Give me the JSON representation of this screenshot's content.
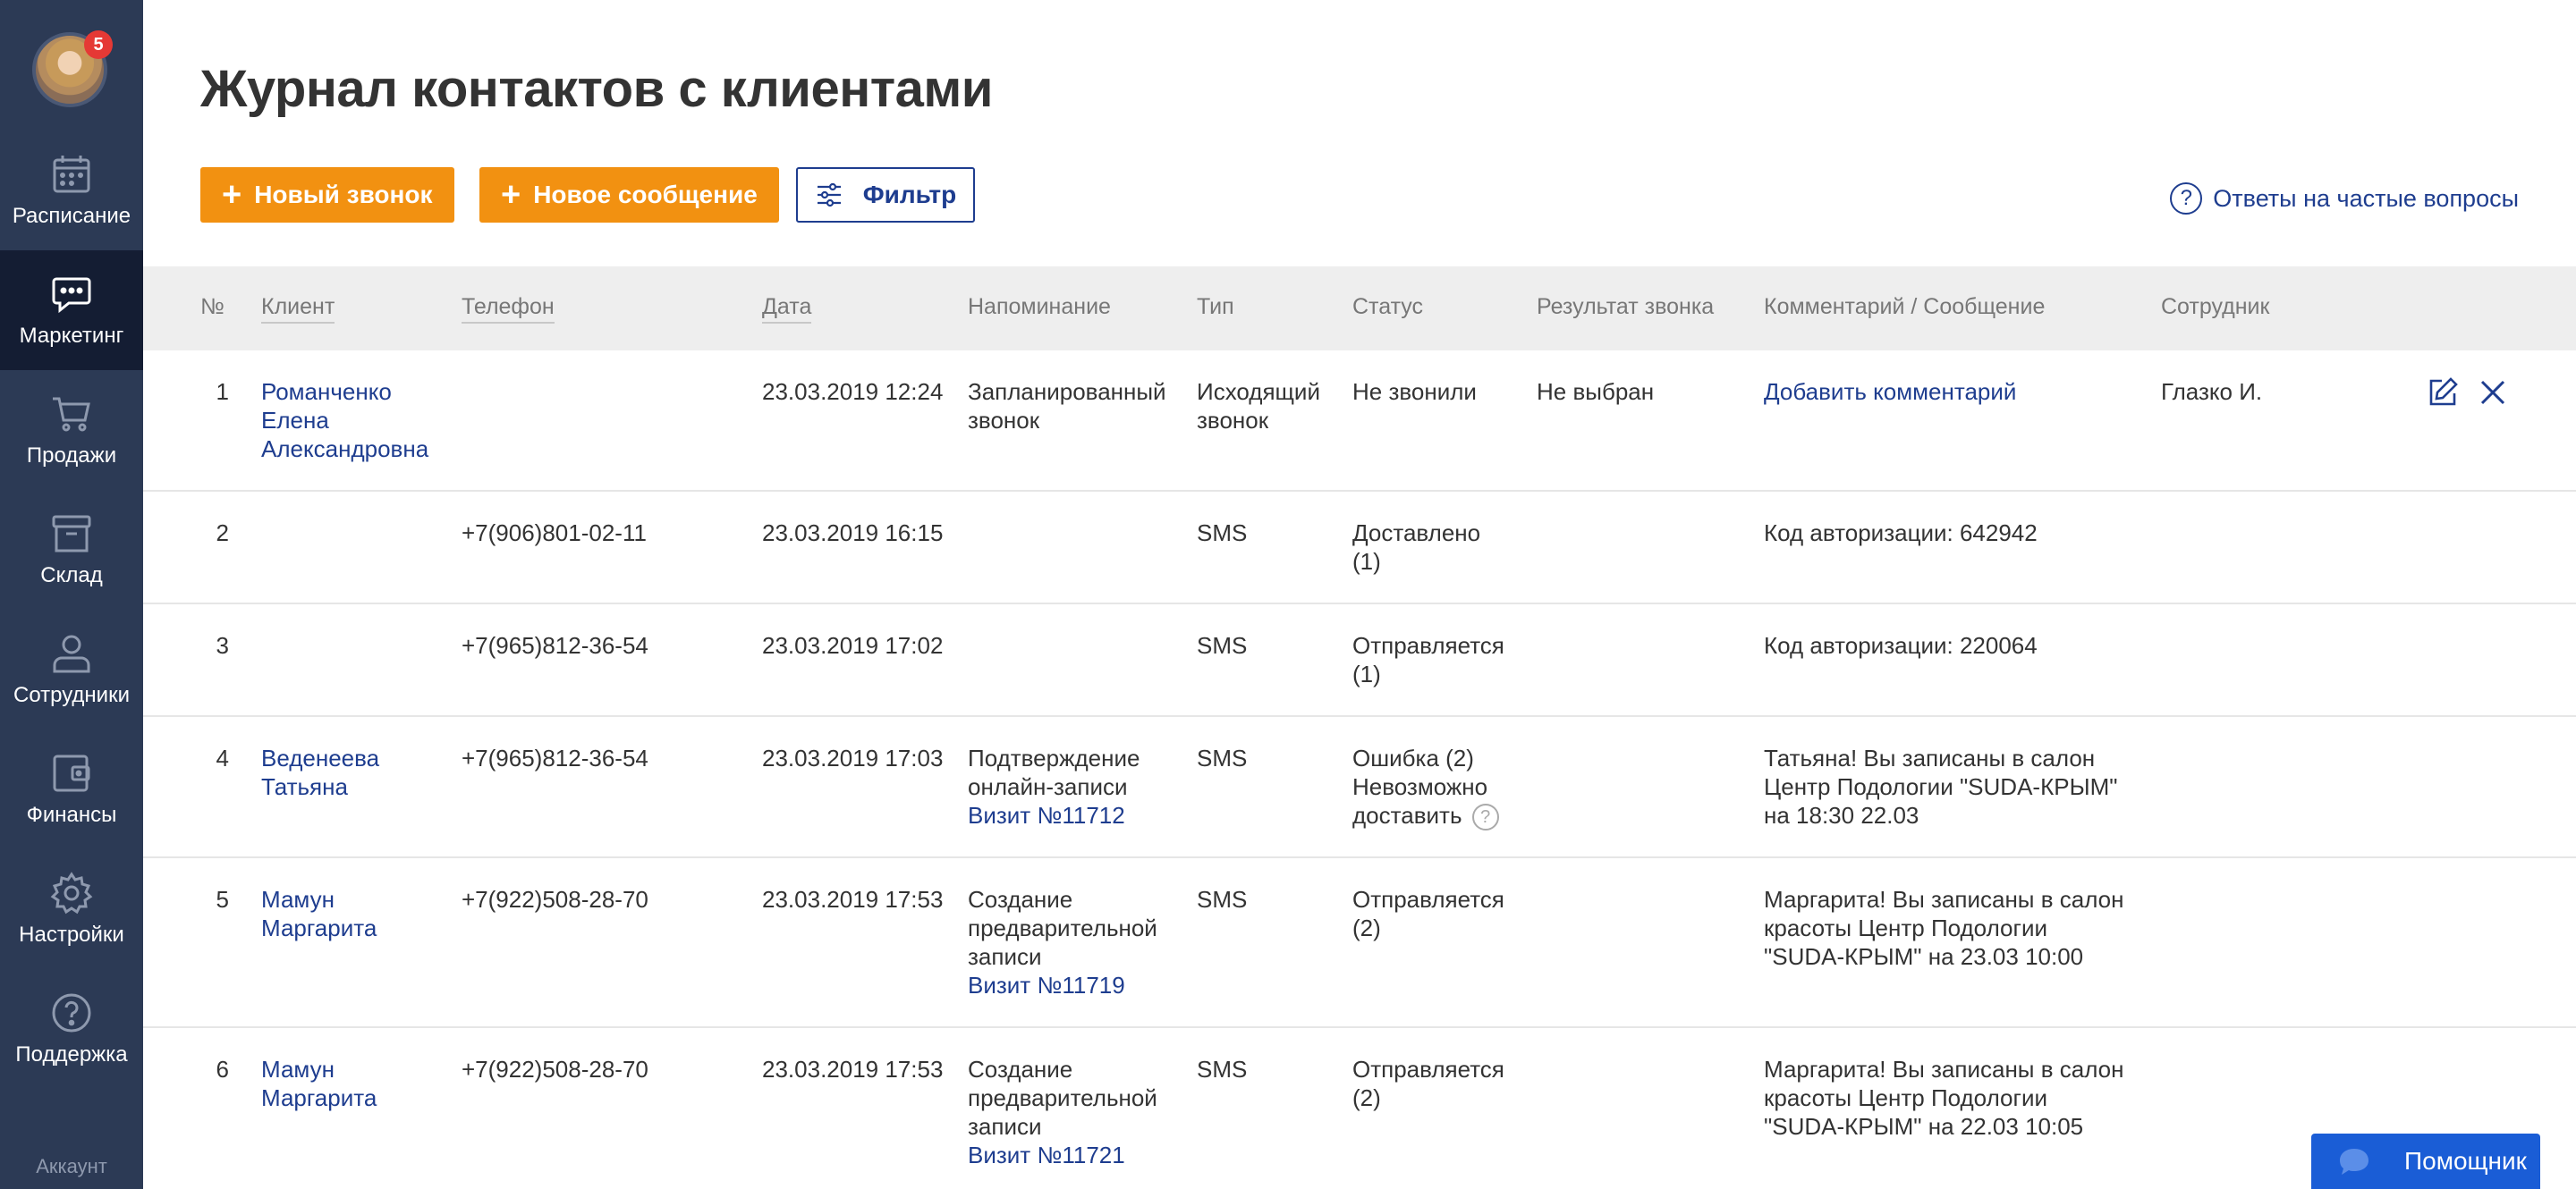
{
  "sidebar": {
    "avatar_badge": "5",
    "items": [
      {
        "label": "Расписание",
        "icon": "calendar-icon"
      },
      {
        "label": "Маркетинг",
        "icon": "chat-icon",
        "active": true
      },
      {
        "label": "Продажи",
        "icon": "cart-icon"
      },
      {
        "label": "Склад",
        "icon": "box-icon"
      },
      {
        "label": "Сотрудники",
        "icon": "user-icon"
      },
      {
        "label": "Финансы",
        "icon": "wallet-icon"
      },
      {
        "label": "Настройки",
        "icon": "gear-icon"
      },
      {
        "label": "Поддержка",
        "icon": "help-icon"
      }
    ],
    "account_label": "Аккаунт"
  },
  "page": {
    "title": "Журнал контактов с клиентами",
    "new_call": "Новый звонок",
    "new_message": "Новое сообщение",
    "filter": "Фильтр",
    "faq": "Ответы на частые вопросы",
    "faq_icon": "?"
  },
  "table": {
    "headers": {
      "num": "№",
      "client": "Клиент",
      "phone": "Телефон",
      "date": "Дата",
      "reminder": "Напоминание",
      "type": "Тип",
      "status": "Статус",
      "result": "Результат звонка",
      "comment": "Комментарий / Сообщение",
      "employee": "Сотрудник"
    },
    "rows": [
      {
        "num": "1",
        "client": [
          "Романченко",
          "Елена",
          "Александровна"
        ],
        "phone": "",
        "date": "23.03.2019 12:24",
        "reminder": [
          "Запланированный",
          "звонок"
        ],
        "type": [
          "Исходящий",
          "звонок"
        ],
        "status": [
          "Не звонили"
        ],
        "result": "Не выбран",
        "comment_link": "Добавить комментарий",
        "employee": "Глазко И."
      },
      {
        "num": "2",
        "phone": "+7(906)801-02-11",
        "date": "23.03.2019 16:15",
        "type": [
          "SMS"
        ],
        "status": [
          "Доставлено",
          "(1)"
        ],
        "comment": [
          "Код авторизации: 642942"
        ]
      },
      {
        "num": "3",
        "phone": "+7(965)812-36-54",
        "date": "23.03.2019 17:02",
        "type": [
          "SMS"
        ],
        "status": [
          "Отправляется",
          "(1)"
        ],
        "comment": [
          "Код авторизации: 220064"
        ]
      },
      {
        "num": "4",
        "client": [
          "Веденеева",
          "Татьяна"
        ],
        "phone": "+7(965)812-36-54",
        "date": "23.03.2019 17:03",
        "reminder": [
          "Подтверждение",
          "онлайн-записи"
        ],
        "visit_link": "Визит №11712",
        "type": [
          "SMS"
        ],
        "status": [
          "Ошибка (2)",
          "Невозможно",
          "доставить"
        ],
        "comment": [
          "Татьяна! Вы записаны в салон",
          "Центр Подологии \"SUDA-КРЫМ\"",
          "на 18:30 22.03"
        ]
      },
      {
        "num": "5",
        "client": [
          "Мамун",
          "Маргарита"
        ],
        "phone": "+7(922)508-28-70",
        "date": "23.03.2019 17:53",
        "reminder": [
          "Создание",
          "предварительной",
          "записи"
        ],
        "visit_link": "Визит №11719",
        "type": [
          "SMS"
        ],
        "status": [
          "Отправляется",
          "(2)"
        ],
        "comment": [
          "Маргарита! Вы записаны в салон",
          "красоты Центр Подологии",
          "\"SUDA-КРЫМ\" на 23.03 10:00"
        ]
      },
      {
        "num": "6",
        "client": [
          "Мамун",
          "Маргарита"
        ],
        "phone": "+7(922)508-28-70",
        "date": "23.03.2019 17:53",
        "reminder": [
          "Создание",
          "предварительной",
          "записи"
        ],
        "visit_link": "Визит №11721",
        "type": [
          "SMS"
        ],
        "status": [
          "Отправляется",
          "(2)"
        ],
        "comment": [
          "Маргарита! Вы записаны в салон",
          "красоты Центр Подологии",
          "\"SUDA-КРЫМ\" на 22.03 10:05"
        ]
      }
    ]
  },
  "helper": {
    "label": "Помощник"
  },
  "colors": {
    "sidebar": "#2c3a55",
    "sidebar_active": "#141d33",
    "accent_orange": "#f29111",
    "link_blue": "#1e3d8f",
    "helper_blue": "#1a5dd6"
  }
}
